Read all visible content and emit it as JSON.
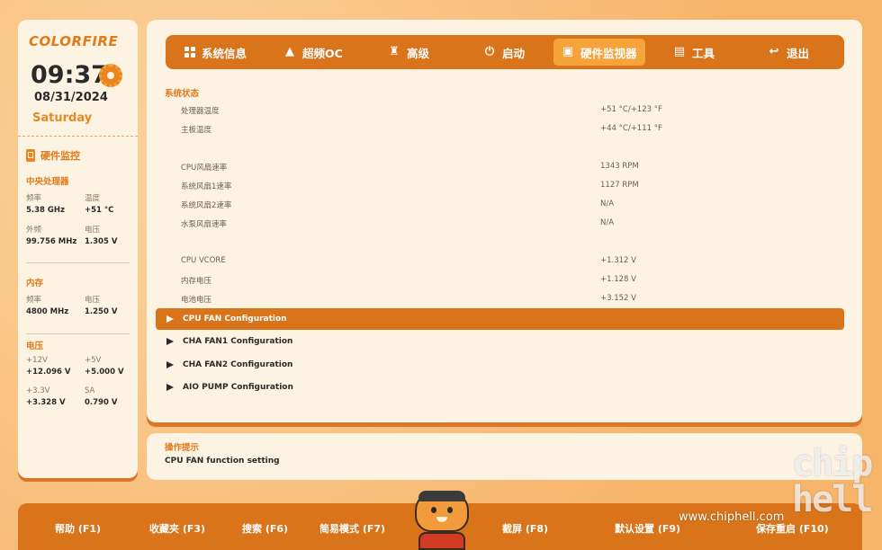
{
  "sidebar": {
    "brand": "COLORFIRE",
    "time": "09:37",
    "date": "08/31/2024",
    "weekday": "Saturday",
    "hw_title": "硬件监控",
    "cpu": {
      "title": "中央处理器",
      "freq_label": "频率",
      "freq_value": "5.38 GHz",
      "temp_label": "温度",
      "temp_value": "+51 °C",
      "bclk_label": "外频",
      "bclk_value": "99.756 MHz",
      "volt_label": "电压",
      "volt_value": "1.305 V"
    },
    "memory": {
      "title": "内存",
      "freq_label": "频率",
      "freq_value": "4800 MHz",
      "volt_label": "电压",
      "volt_value": "1.250 V"
    },
    "voltage": {
      "title": "电压",
      "v12_label": "+12V",
      "v12_value": "+12.096 V",
      "v5_label": "+5V",
      "v5_value": "+5.000 V",
      "v33_label": "+3.3V",
      "v33_value": "+3.328 V",
      "sa_label": "SA",
      "sa_value": "0.790 V"
    }
  },
  "tabs": [
    {
      "label": "系统信息",
      "icon": "grid-icon"
    },
    {
      "label": "超频OC",
      "icon": "rocket-icon"
    },
    {
      "label": "高级",
      "icon": "crown-icon"
    },
    {
      "label": "启动",
      "icon": "power-icon"
    },
    {
      "label": "硬件监视器",
      "icon": "monitor-icon",
      "active": true
    },
    {
      "label": "工具",
      "icon": "toolbox-icon"
    },
    {
      "label": "退出",
      "icon": "back-arrow-icon"
    }
  ],
  "status": {
    "title": "系统状态",
    "rows": [
      {
        "label": "处理器温度",
        "value": "+51 °C/+123 °F"
      },
      {
        "label": "主板温度",
        "value": "+44 °C/+111 °F"
      },
      {
        "label": "CPU风扇速率",
        "value": "1343 RPM"
      },
      {
        "label": "系统风扇1速率",
        "value": "1127 RPM"
      },
      {
        "label": "系统风扇2速率",
        "value": "N/A"
      },
      {
        "label": "水泵风扇速率",
        "value": "N/A"
      },
      {
        "label": "CPU VCORE",
        "value": "+1.312 V"
      },
      {
        "label": "内存电压",
        "value": "+1.128 V"
      },
      {
        "label": "电池电压",
        "value": "+3.152 V"
      }
    ]
  },
  "configs": [
    {
      "label": "CPU FAN Configuration",
      "selected": true
    },
    {
      "label": "CHA FAN1 Configuration"
    },
    {
      "label": "CHA FAN2 Configuration"
    },
    {
      "label": "AIO PUMP Configuration"
    }
  ],
  "hint": {
    "title": "操作提示",
    "text": "CPU FAN function setting"
  },
  "bottom": {
    "help": "帮助 (F1)",
    "favorites": "收藏夹 (F3)",
    "search": "搜索 (F6)",
    "easy_mode": "简易模式 (F7)",
    "screenshot": "截屏 (F8)",
    "defaults": "默认设置 (F9)",
    "save_reboot": "保存重启 (F10)"
  },
  "watermark": {
    "site": "www.chiphell.com",
    "logo_top": "chip",
    "logo_bottom": "hell"
  },
  "colors": {
    "accent": "#d9741b",
    "accent_light": "#f7a33b",
    "panel": "#fdf3e3",
    "label": "#e07a1a"
  }
}
